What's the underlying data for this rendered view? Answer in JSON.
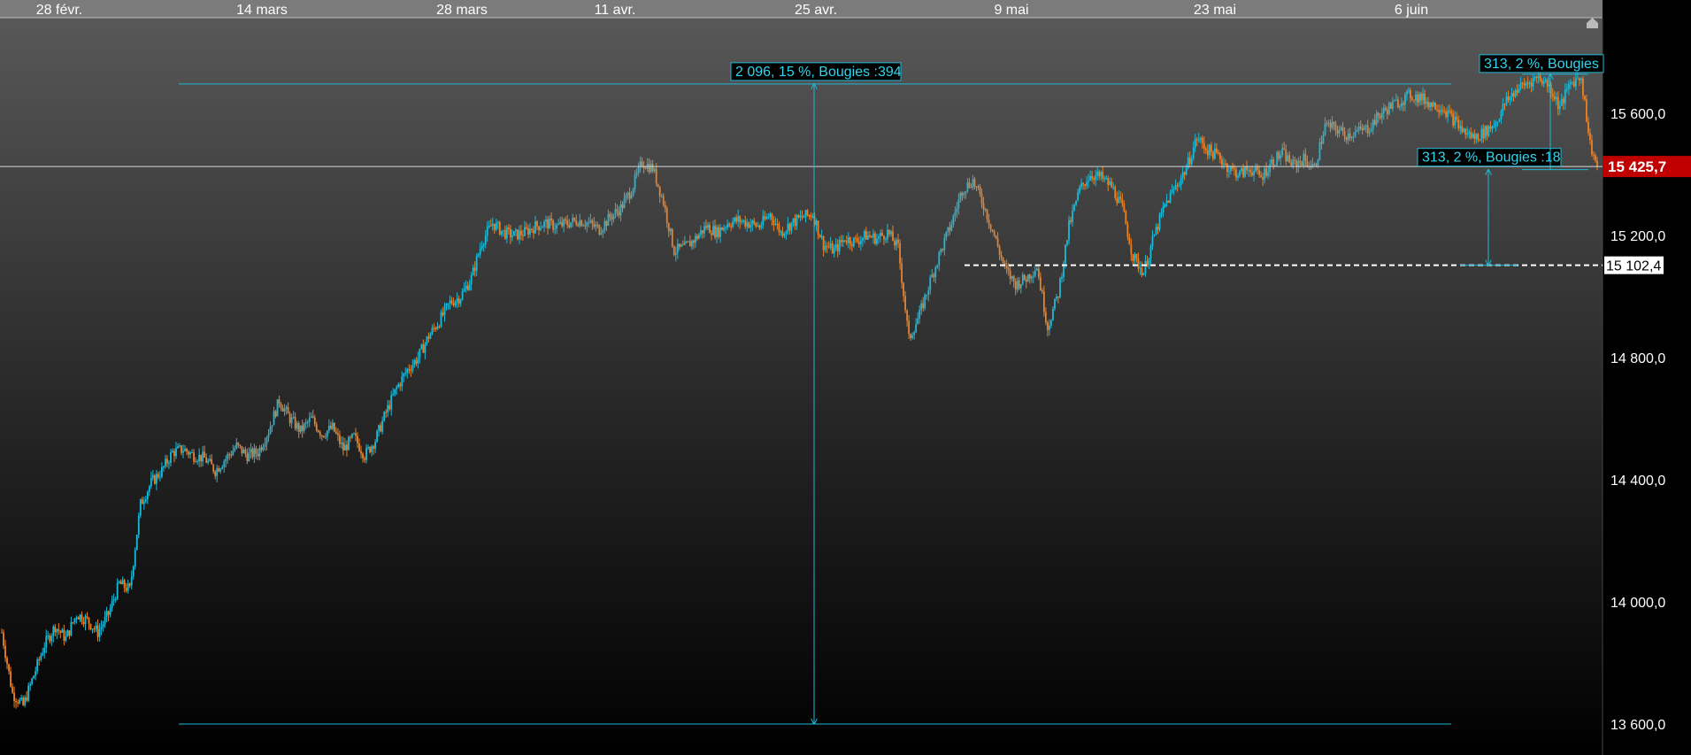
{
  "chart_data": {
    "type": "candlestick",
    "x_tick_labels": [
      "28 févr.",
      "14 mars",
      "28 mars",
      "11 avr.",
      "25 avr.",
      "9 mai",
      "23 mai",
      "6 juin"
    ],
    "y_tick_labels": [
      "15 600,0",
      "15 200,0",
      "14 800,0",
      "14 400,0",
      "14 000,0",
      "13 600,0"
    ],
    "y_ticks": [
      15600,
      15200,
      14800,
      14400,
      14000,
      13600
    ],
    "ylim": [
      13550,
      15900
    ],
    "colors": {
      "up": "#1fb8d6",
      "down": "#e8822a",
      "measure": "#1fb8d6",
      "last_price_bg": "#c00000"
    },
    "last_price": 15425.7,
    "last_price_label": "15 425,7",
    "reference_level": 15102.4,
    "reference_label": "15 102,4",
    "measures": [
      {
        "label": "2 096, 15 %, Bougies :394",
        "from": 13600,
        "to": 15696
      },
      {
        "label": "313, 2 %, Bougies :18",
        "from": 15102.4,
        "to": 15415.4
      },
      {
        "label": "313, 2 %, Bougies",
        "from": 15415.4,
        "to": 15728
      }
    ],
    "close_path": [
      [
        0,
        13900
      ],
      [
        6,
        13700
      ],
      [
        12,
        13660
      ],
      [
        18,
        13760
      ],
      [
        24,
        13860
      ],
      [
        30,
        13920
      ],
      [
        36,
        13880
      ],
      [
        42,
        13960
      ],
      [
        48,
        13940
      ],
      [
        54,
        13900
      ],
      [
        60,
        13960
      ],
      [
        66,
        14060
      ],
      [
        72,
        14040
      ],
      [
        78,
        14320
      ],
      [
        84,
        14390
      ],
      [
        90,
        14430
      ],
      [
        96,
        14490
      ],
      [
        102,
        14500
      ],
      [
        108,
        14480
      ],
      [
        114,
        14470
      ],
      [
        120,
        14430
      ],
      [
        126,
        14470
      ],
      [
        132,
        14510
      ],
      [
        138,
        14480
      ],
      [
        144,
        14490
      ],
      [
        150,
        14560
      ],
      [
        156,
        14660
      ],
      [
        162,
        14600
      ],
      [
        168,
        14560
      ],
      [
        174,
        14600
      ],
      [
        180,
        14550
      ],
      [
        186,
        14570
      ],
      [
        192,
        14500
      ],
      [
        198,
        14540
      ],
      [
        204,
        14480
      ],
      [
        210,
        14530
      ],
      [
        216,
        14620
      ],
      [
        222,
        14700
      ],
      [
        228,
        14760
      ],
      [
        234,
        14800
      ],
      [
        240,
        14870
      ],
      [
        246,
        14920
      ],
      [
        252,
        14980
      ],
      [
        258,
        15000
      ],
      [
        264,
        15060
      ],
      [
        270,
        15180
      ],
      [
        276,
        15240
      ],
      [
        282,
        15210
      ],
      [
        288,
        15200
      ],
      [
        294,
        15210
      ],
      [
        300,
        15230
      ],
      [
        306,
        15240
      ],
      [
        312,
        15230
      ],
      [
        318,
        15240
      ],
      [
        324,
        15250
      ],
      [
        330,
        15240
      ],
      [
        336,
        15220
      ],
      [
        342,
        15260
      ],
      [
        348,
        15290
      ],
      [
        354,
        15350
      ],
      [
        360,
        15440
      ],
      [
        366,
        15420
      ],
      [
        372,
        15310
      ],
      [
        378,
        15150
      ],
      [
        384,
        15160
      ],
      [
        390,
        15190
      ],
      [
        396,
        15230
      ],
      [
        402,
        15210
      ],
      [
        408,
        15240
      ],
      [
        414,
        15250
      ],
      [
        420,
        15240
      ],
      [
        426,
        15230
      ],
      [
        432,
        15270
      ],
      [
        438,
        15210
      ],
      [
        444,
        15240
      ],
      [
        450,
        15260
      ],
      [
        456,
        15270
      ],
      [
        462,
        15170
      ],
      [
        468,
        15150
      ],
      [
        474,
        15190
      ],
      [
        480,
        15180
      ],
      [
        486,
        15200
      ],
      [
        492,
        15190
      ],
      [
        498,
        15210
      ],
      [
        504,
        15160
      ],
      [
        510,
        14860
      ],
      [
        516,
        14940
      ],
      [
        522,
        15050
      ],
      [
        528,
        15150
      ],
      [
        534,
        15240
      ],
      [
        540,
        15350
      ],
      [
        546,
        15380
      ],
      [
        552,
        15300
      ],
      [
        558,
        15200
      ],
      [
        564,
        15090
      ],
      [
        570,
        15040
      ],
      [
        576,
        15060
      ],
      [
        582,
        15100
      ],
      [
        588,
        14900
      ],
      [
        594,
        15010
      ],
      [
        600,
        15230
      ],
      [
        606,
        15350
      ],
      [
        612,
        15400
      ],
      [
        618,
        15390
      ],
      [
        624,
        15360
      ],
      [
        630,
        15290
      ],
      [
        636,
        15130
      ],
      [
        642,
        15080
      ],
      [
        648,
        15200
      ],
      [
        654,
        15300
      ],
      [
        660,
        15360
      ],
      [
        666,
        15420
      ],
      [
        672,
        15520
      ],
      [
        678,
        15480
      ],
      [
        684,
        15460
      ],
      [
        690,
        15420
      ],
      [
        696,
        15400
      ],
      [
        702,
        15420
      ],
      [
        708,
        15390
      ],
      [
        714,
        15440
      ],
      [
        720,
        15470
      ],
      [
        726,
        15430
      ],
      [
        732,
        15450
      ],
      [
        738,
        15420
      ],
      [
        744,
        15560
      ],
      [
        750,
        15550
      ],
      [
        756,
        15530
      ],
      [
        762,
        15540
      ],
      [
        768,
        15550
      ],
      [
        774,
        15590
      ],
      [
        780,
        15620
      ],
      [
        786,
        15640
      ],
      [
        792,
        15660
      ],
      [
        798,
        15650
      ],
      [
        804,
        15630
      ],
      [
        810,
        15620
      ],
      [
        816,
        15580
      ],
      [
        822,
        15540
      ],
      [
        828,
        15520
      ],
      [
        834,
        15540
      ],
      [
        840,
        15570
      ],
      [
        846,
        15640
      ],
      [
        852,
        15680
      ],
      [
        858,
        15700
      ],
      [
        864,
        15720
      ],
      [
        870,
        15690
      ],
      [
        876,
        15620
      ],
      [
        882,
        15700
      ],
      [
        888,
        15720
      ],
      [
        893,
        15500
      ],
      [
        897,
        15425.7
      ]
    ]
  }
}
